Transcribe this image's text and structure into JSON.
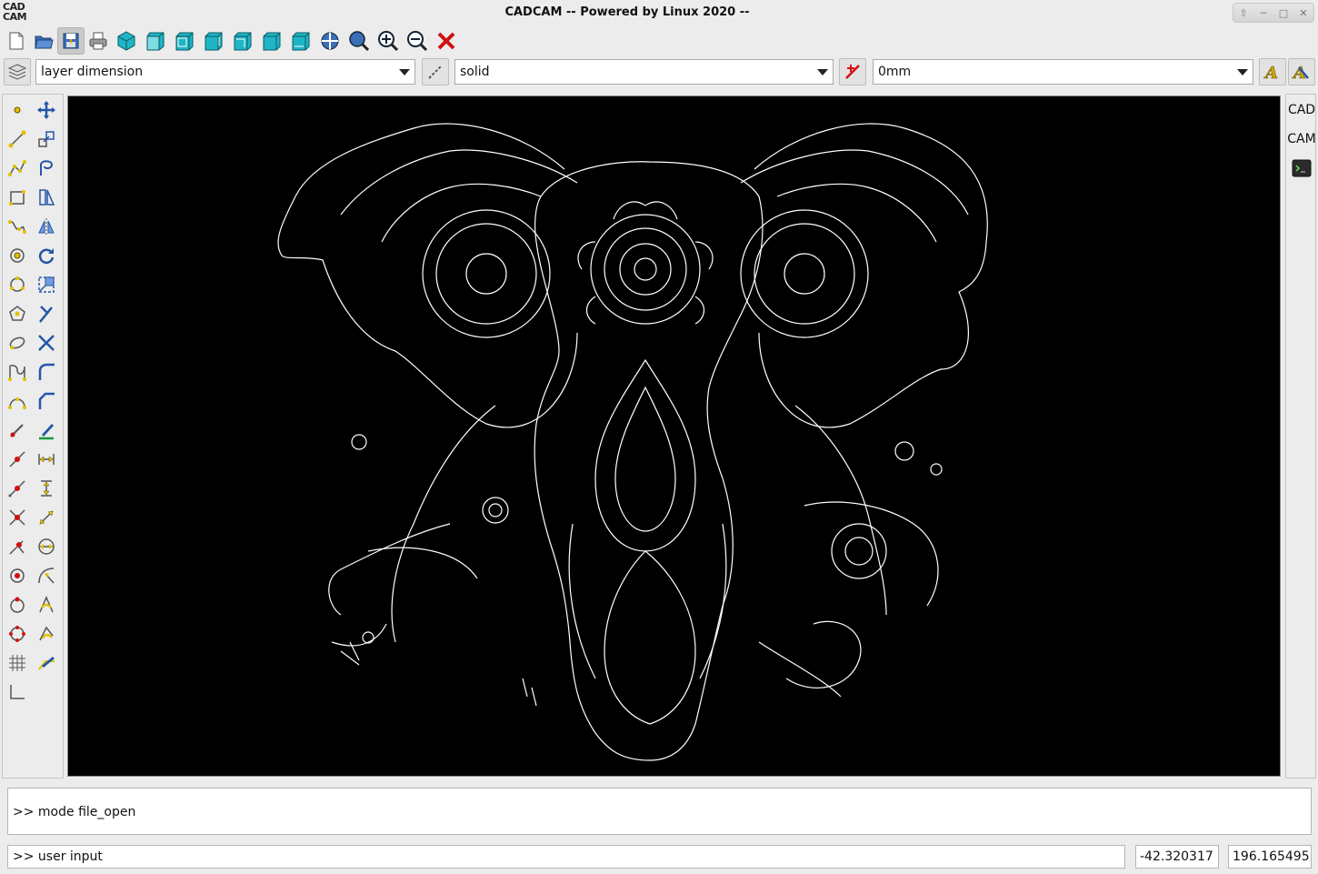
{
  "app": {
    "logo_line1": "CAD",
    "logo_line2": "CAM",
    "title": "CADCAM -- Powered by Linux 2020 --"
  },
  "toolbar": {
    "buttons": [
      "new-file",
      "open-file",
      "save-file",
      "print",
      "view-3d-solid",
      "view-front",
      "view-top",
      "view-right",
      "view-left",
      "view-back",
      "view-bottom",
      "zoom-fit",
      "zoom-window",
      "zoom-in",
      "zoom-out",
      "close"
    ]
  },
  "properties": {
    "layer": "layer dimension",
    "linetype": "solid",
    "lineweight": "0mm"
  },
  "right_panel": {
    "cad_label": "CAD",
    "cam_label": "CAM"
  },
  "console": {
    "output": ">> mode file_open",
    "input": ">> user input"
  },
  "coords": {
    "x": "-42.320317",
    "y": "196.165495"
  },
  "colors": {
    "canvas_bg": "#000000",
    "accent_teal": "#1fb5c4",
    "tool_yellow": "#e0c000",
    "close_red": "#d01010"
  }
}
